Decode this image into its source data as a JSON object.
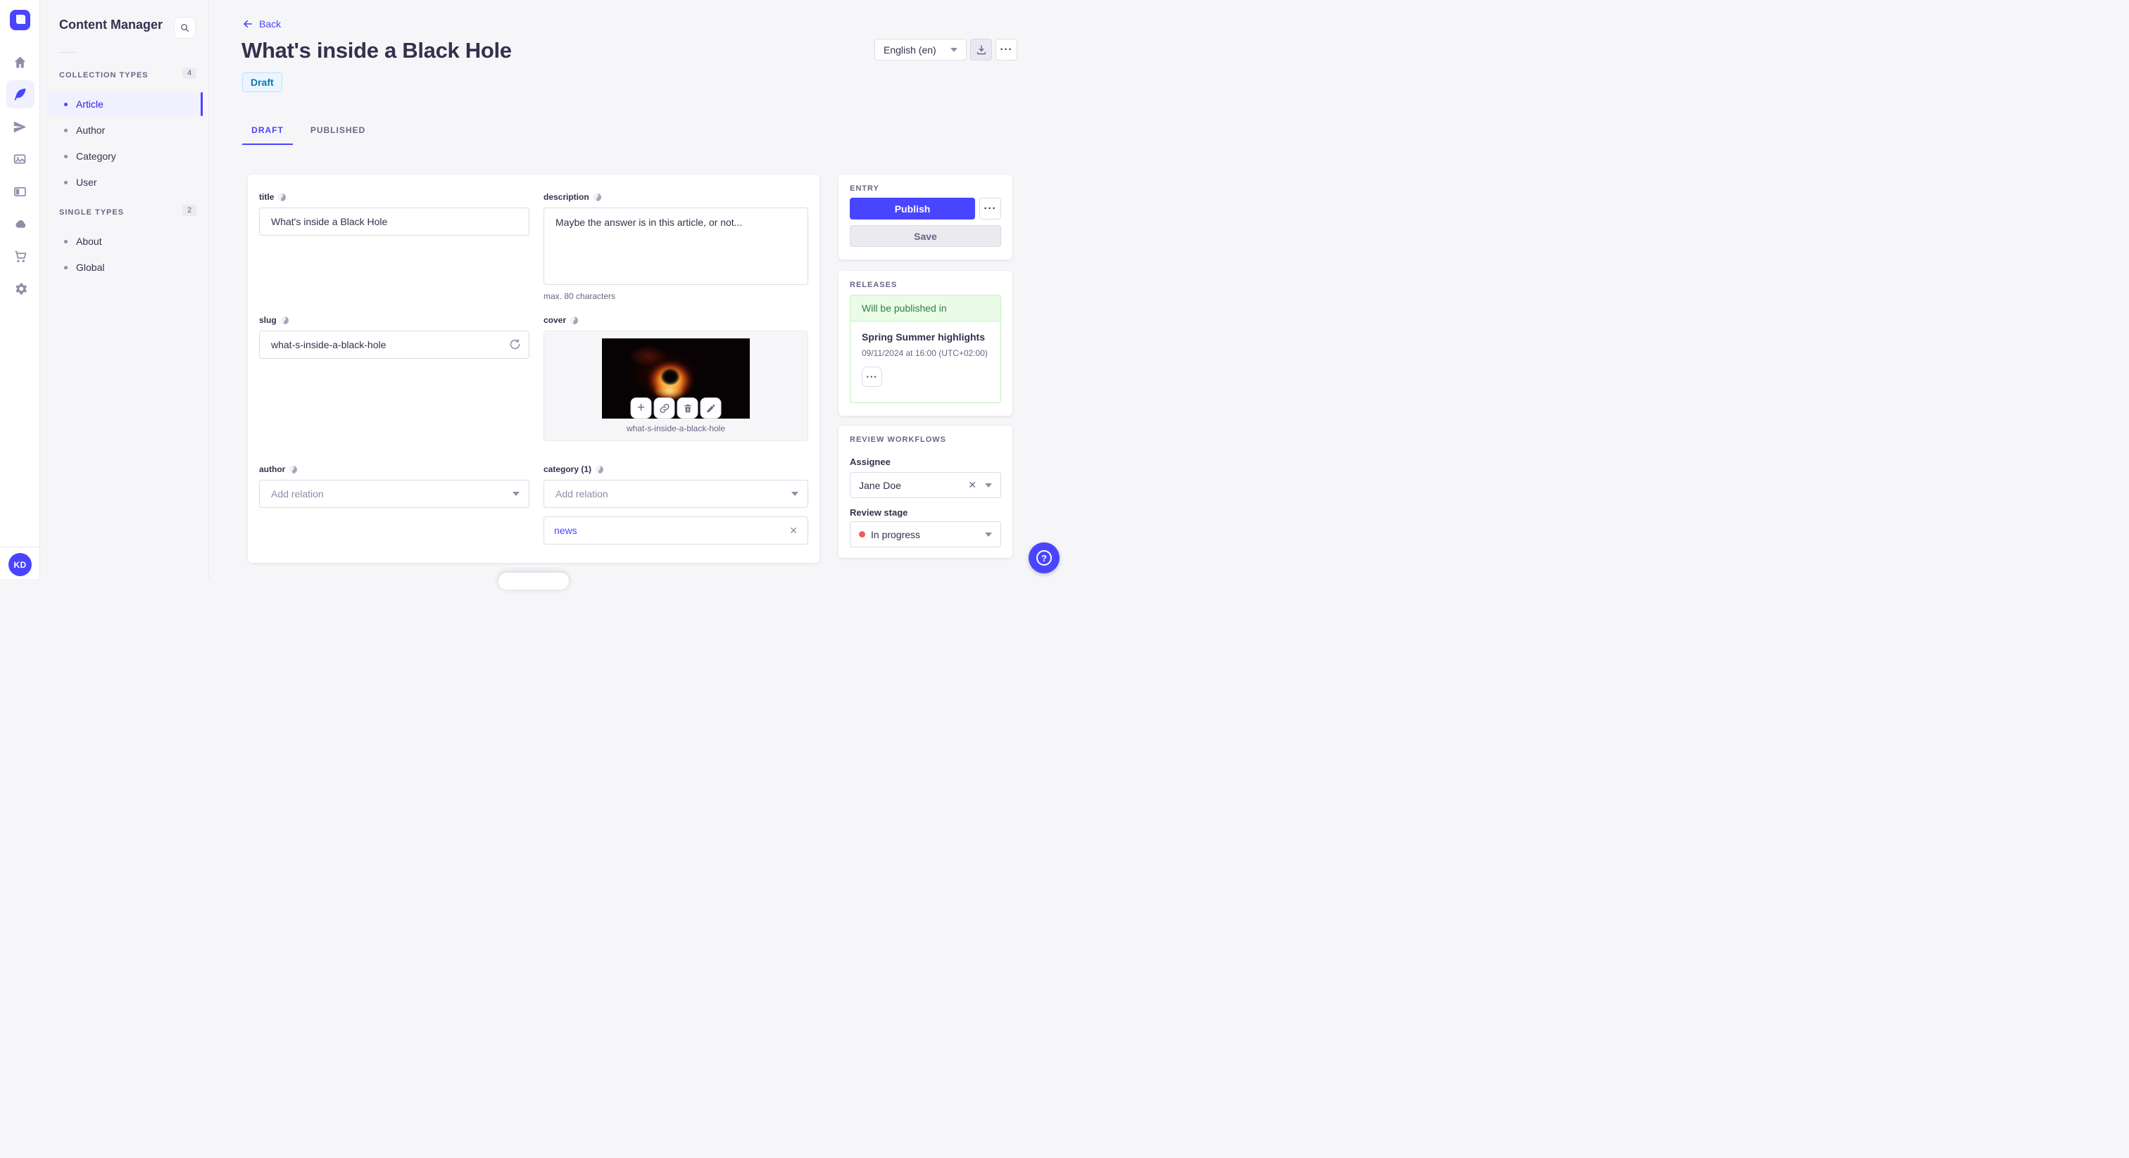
{
  "colors": {
    "accent": "#4945ff",
    "active_text": "#271fe0",
    "draft_bg": "#eaf5ff",
    "draft_border": "#b8e1ff",
    "draft_text": "#0c75af",
    "release_bg": "#eafbe7",
    "release_border": "#c6f0c2",
    "release_text": "#328048",
    "stage_dot": "#ee5e52",
    "background": "#f6f6f9"
  },
  "icons": {
    "more_glyph": "···",
    "close_glyph": "✕",
    "plus_glyph": "+",
    "question_glyph": "?"
  },
  "sidebar": {
    "title": "Content Manager",
    "sections": [
      {
        "label": "COLLECTION TYPES",
        "count": "4",
        "items": [
          {
            "label": "Article",
            "active": true
          },
          {
            "label": "Author"
          },
          {
            "label": "Category"
          },
          {
            "label": "User"
          }
        ]
      },
      {
        "label": "SINGLE TYPES",
        "count": "2",
        "items": [
          {
            "label": "About"
          },
          {
            "label": "Global"
          }
        ]
      }
    ]
  },
  "user": {
    "initials": "KD"
  },
  "header": {
    "back_label": "Back",
    "title": "What's inside a Black Hole",
    "status_badge": "Draft",
    "locale": "English (en)",
    "tabs": [
      {
        "label": "DRAFT",
        "active": true
      },
      {
        "label": "PUBLISHED",
        "active": false
      }
    ]
  },
  "form": {
    "title": {
      "label": "title",
      "value": "What's inside a Black Hole"
    },
    "description": {
      "label": "description",
      "value": "Maybe the answer is in this article, or not...",
      "hint": "max. 80 characters"
    },
    "slug": {
      "label": "slug",
      "value": "what-s-inside-a-black-hole"
    },
    "cover": {
      "label": "cover",
      "filename": "what-s-inside-a-black-hole"
    },
    "author": {
      "label": "author",
      "placeholder": "Add relation"
    },
    "category": {
      "label": "category (1)",
      "placeholder": "Add relation",
      "relations": [
        {
          "label": "news"
        }
      ]
    }
  },
  "entry_panel": {
    "title": "ENTRY",
    "publish_label": "Publish",
    "save_label": "Save"
  },
  "releases_panel": {
    "title": "RELEASES",
    "status": "Will be published in",
    "release_name": "Spring Summer highlights",
    "release_date": "09/11/2024 at 16:00 (UTC+02:00)"
  },
  "review_panel": {
    "title": "REVIEW WORKFLOWS",
    "assignee_label": "Assignee",
    "assignee_value": "Jane Doe",
    "stage_label": "Review stage",
    "stage_value": "In progress"
  }
}
